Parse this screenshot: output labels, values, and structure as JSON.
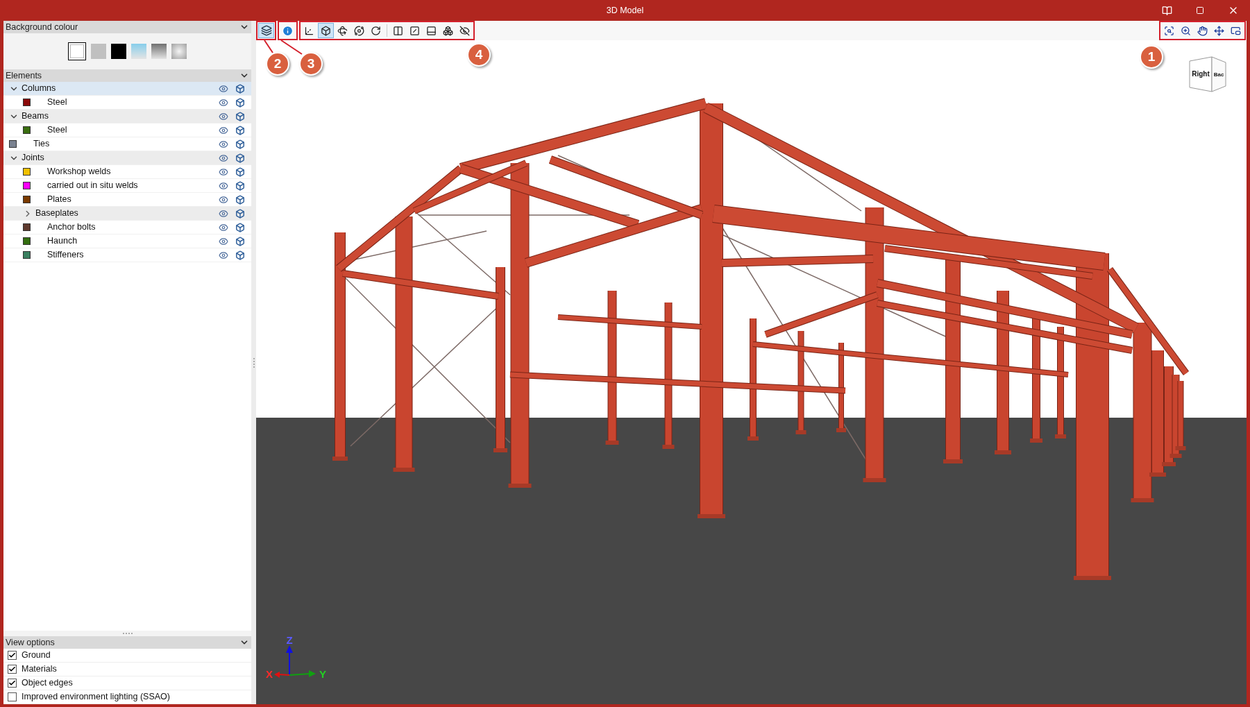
{
  "window": {
    "title": "3D Model"
  },
  "background_colour": {
    "title": "Background colour",
    "swatches": [
      {
        "kind": "solid",
        "color": "#ffffff",
        "selected": true
      },
      {
        "kind": "solid",
        "color": "#c0c0c0",
        "selected": false
      },
      {
        "kind": "solid",
        "color": "#000000",
        "selected": false
      },
      {
        "kind": "sky_gradient",
        "selected": false
      },
      {
        "kind": "grey_gradient",
        "selected": false
      },
      {
        "kind": "radial_gradient",
        "selected": false
      }
    ]
  },
  "elements": {
    "title": "Elements",
    "items": [
      {
        "label": "Columns",
        "expanded": true,
        "selected": true,
        "children": [
          {
            "label": "Steel",
            "color": "#8b0a0a",
            "selected": false
          }
        ]
      },
      {
        "label": "Beams",
        "expanded": true,
        "selected": false,
        "children": [
          {
            "label": "Steel",
            "color": "#3a6e10",
            "selected": false
          }
        ]
      },
      {
        "label": "Ties",
        "color": "#7a8290",
        "selected": false
      },
      {
        "label": "Joints",
        "expanded": true,
        "selected": false,
        "children": [
          {
            "label": "Workshop welds",
            "color": "#f0c000",
            "selected": false
          },
          {
            "label": "carried out in situ welds",
            "color": "#ff00ff",
            "selected": false
          },
          {
            "label": "Plates",
            "color": "#7a3a00",
            "selected": false
          },
          {
            "label": "Baseplates",
            "expanded": false,
            "selected": false
          },
          {
            "label": "Anchor bolts",
            "color": "#5e3a2e",
            "selected": false
          },
          {
            "label": "Haunch",
            "color": "#336e10",
            "selected": false
          },
          {
            "label": "Stiffeners",
            "color": "#3a8060",
            "selected": false
          }
        ]
      }
    ]
  },
  "view_options": {
    "title": "View options",
    "options": [
      {
        "label": "Ground",
        "checked": true
      },
      {
        "label": "Materials",
        "checked": true
      },
      {
        "label": "Object edges",
        "checked": true
      },
      {
        "label": "Improved environment lighting (SSAO)",
        "checked": false
      }
    ]
  },
  "toolbar": {
    "layers": {
      "on": true
    },
    "info": {
      "on": false
    },
    "view_tools": [
      {
        "on": false
      },
      {
        "on": true
      },
      {
        "on": false
      },
      {
        "on": false
      },
      {
        "on": false
      },
      {
        "on": false
      },
      {
        "on": false
      },
      {
        "on": false
      },
      {
        "on": false
      },
      {
        "on": false
      }
    ]
  },
  "callouts": {
    "navigation": "1",
    "layers": "2",
    "info": "3",
    "view_tools": "4"
  },
  "view_cube": {
    "faces": [
      "Right",
      "Bac"
    ]
  },
  "axes": {
    "x": "X",
    "y": "Y",
    "z": "Z"
  }
}
